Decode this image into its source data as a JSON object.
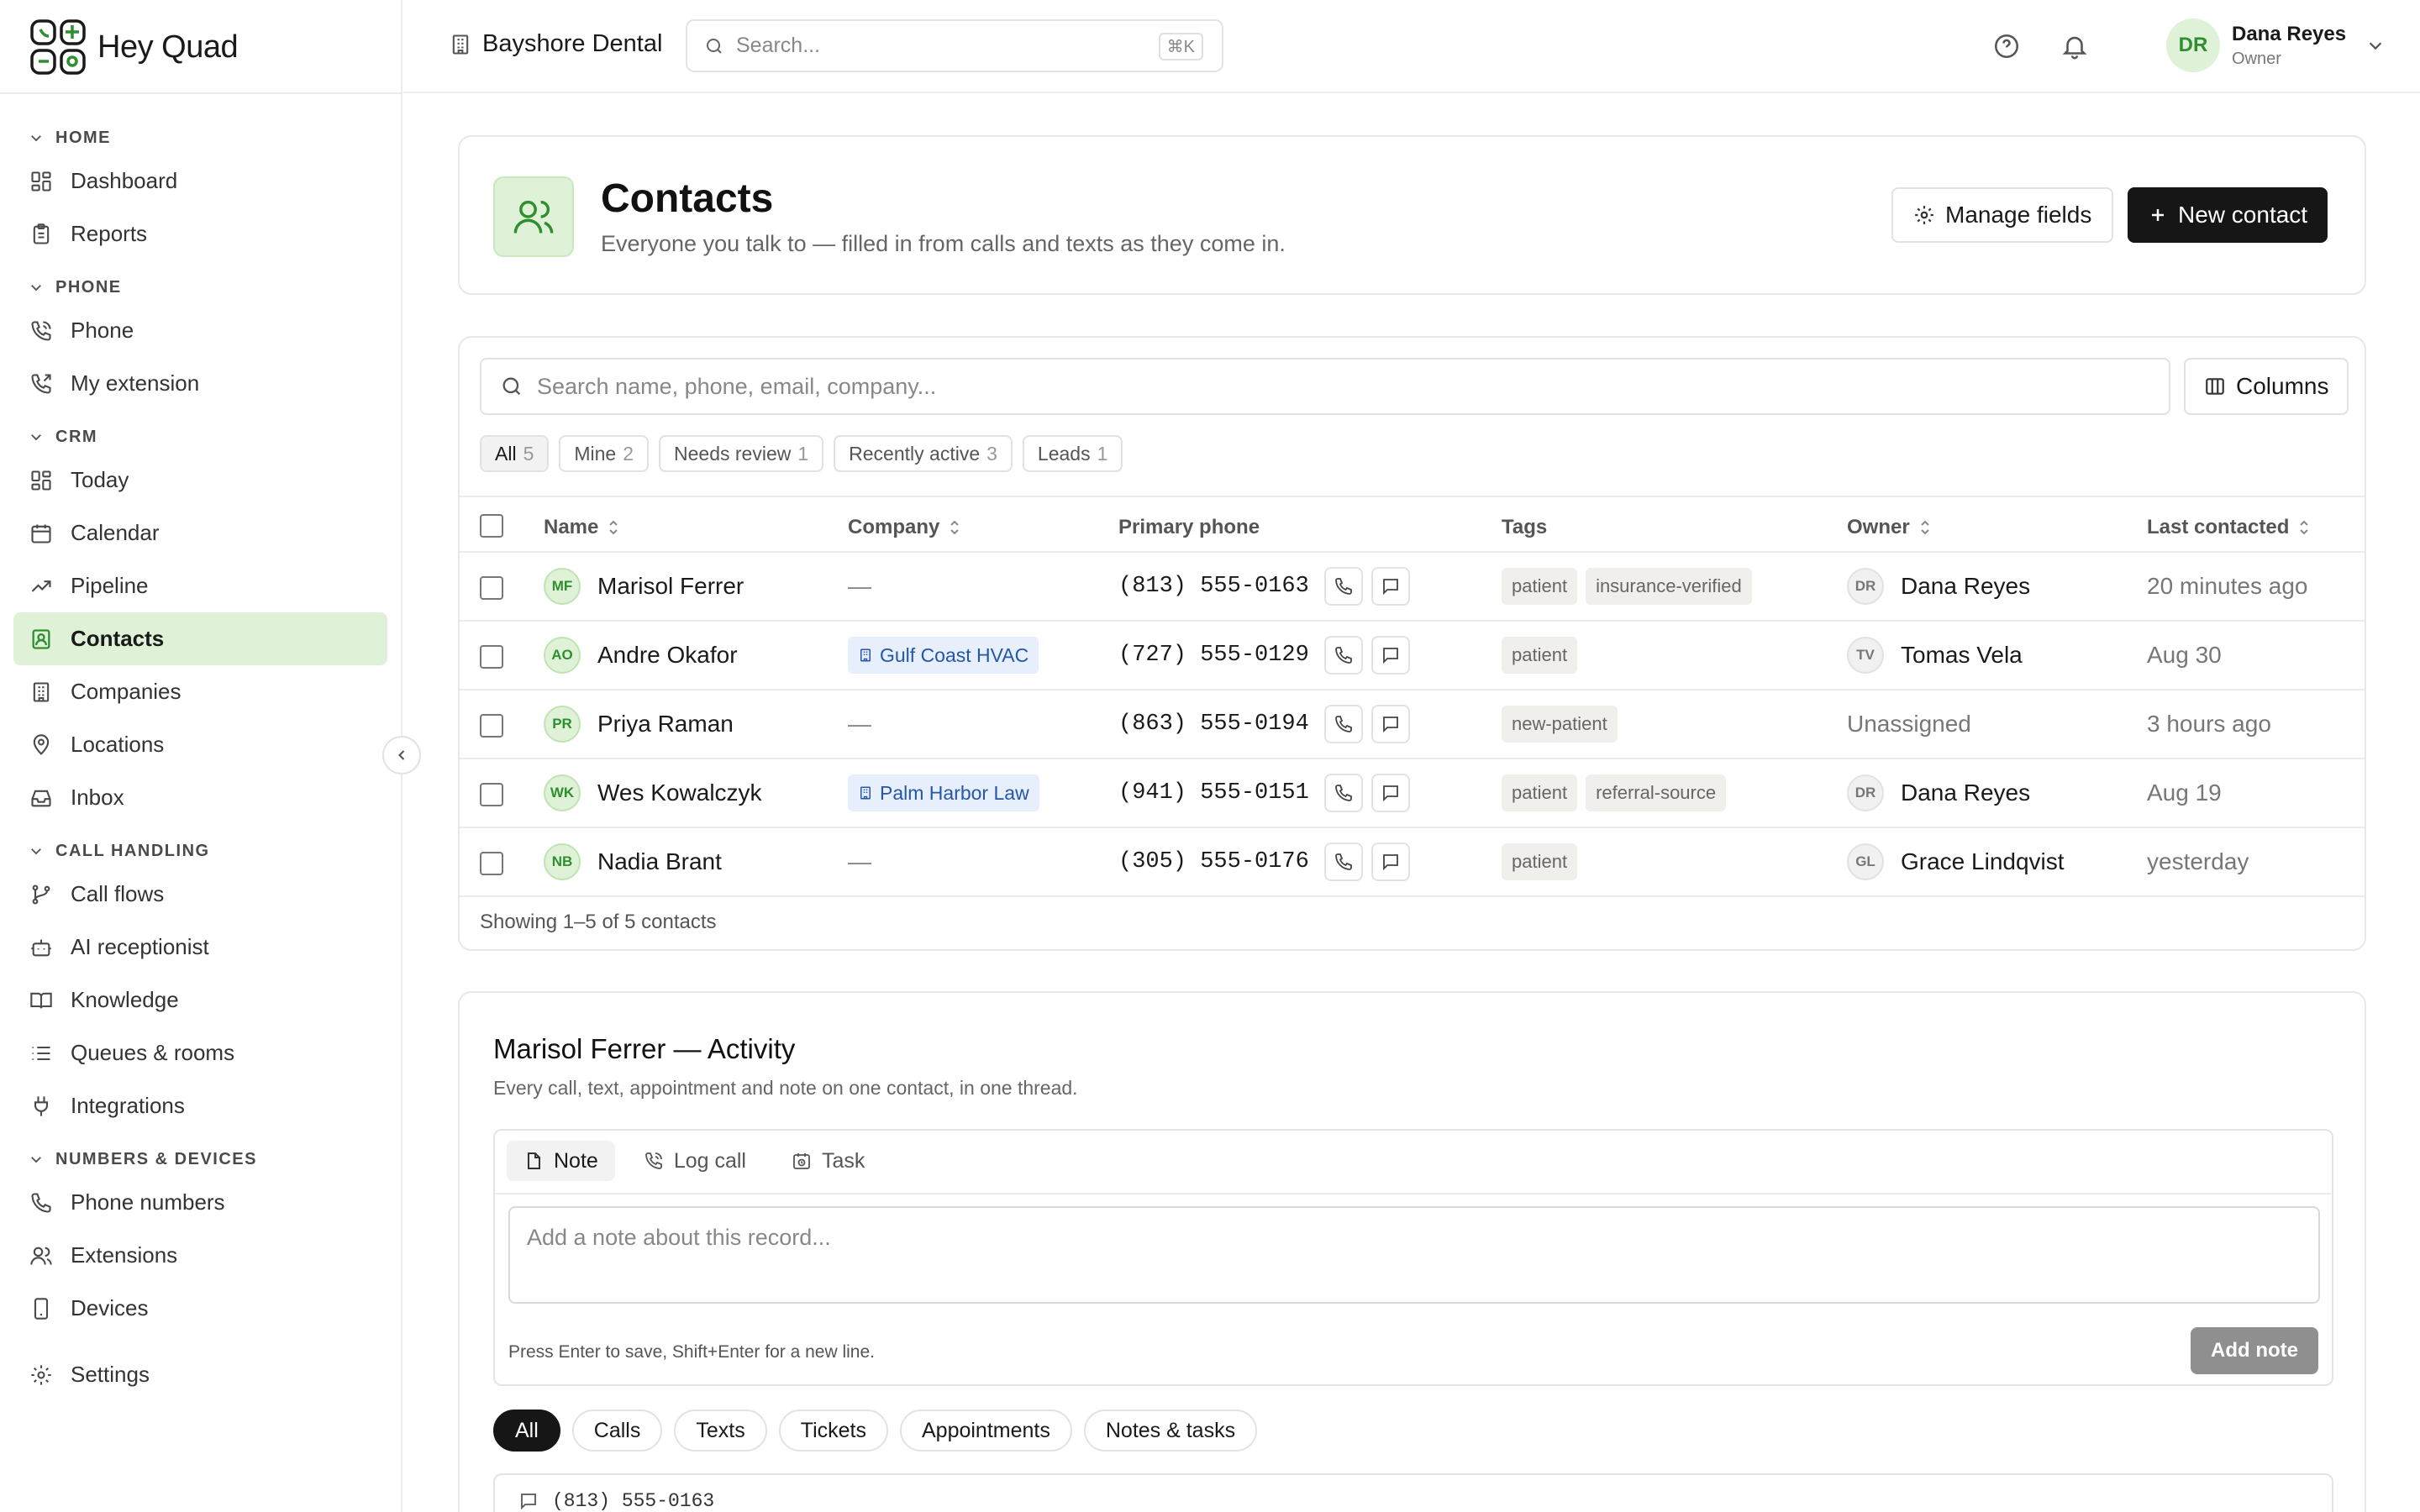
{
  "app": {
    "name": "Hey Quad"
  },
  "topbar": {
    "org_name": "Bayshore Dental",
    "search_placeholder": "Search...",
    "search_shortcut": "⌘K",
    "user": {
      "initials": "DR",
      "name": "Dana Reyes",
      "role": "Owner"
    }
  },
  "sidebar": {
    "groups": {
      "home": "HOME",
      "phone": "PHONE",
      "crm": "CRM",
      "call_handling": "CALL HANDLING",
      "numbers_devices": "NUMBERS & DEVICES"
    },
    "items": {
      "dashboard": "Dashboard",
      "reports": "Reports",
      "phone": "Phone",
      "my_extension": "My extension",
      "today": "Today",
      "calendar": "Calendar",
      "pipeline": "Pipeline",
      "contacts": "Contacts",
      "companies": "Companies",
      "locations": "Locations",
      "inbox": "Inbox",
      "call_flows": "Call flows",
      "ai_receptionist": "AI receptionist",
      "knowledge": "Knowledge",
      "queues_rooms": "Queues & rooms",
      "integrations": "Integrations",
      "phone_numbers": "Phone numbers",
      "extensions": "Extensions",
      "devices": "Devices",
      "settings": "Settings"
    },
    "active": "contacts"
  },
  "header": {
    "title": "Contacts",
    "subtitle": "Everyone you talk to — filled in from calls and texts as they come in.",
    "manage_fields_label": "Manage fields",
    "new_contact_label": "New contact"
  },
  "table": {
    "search_placeholder": "Search name, phone, email, company...",
    "columns_label": "Columns",
    "filters": [
      {
        "label": "All",
        "count": "5"
      },
      {
        "label": "Mine",
        "count": "2"
      },
      {
        "label": "Needs review",
        "count": "1"
      },
      {
        "label": "Recently active",
        "count": "3"
      },
      {
        "label": "Leads",
        "count": "1"
      }
    ],
    "headers": {
      "name": "Name",
      "company": "Company",
      "primary_phone": "Primary phone",
      "tags": "Tags",
      "owner": "Owner",
      "last_contacted": "Last contacted"
    },
    "rows": [
      {
        "initials": "MF",
        "name": "Marisol Ferrer",
        "company": "—",
        "phone": "(813) 555-0163",
        "tags": [
          "patient",
          "insurance-verified"
        ],
        "owner_initials": "DR",
        "owner": "Dana Reyes",
        "last": "20 minutes ago"
      },
      {
        "initials": "AO",
        "name": "Andre Okafor",
        "company": "Gulf Coast HVAC",
        "phone": "(727) 555-0129",
        "tags": [
          "patient"
        ],
        "owner_initials": "TV",
        "owner": "Tomas Vela",
        "last": "Aug 30"
      },
      {
        "initials": "PR",
        "name": "Priya Raman",
        "company": "—",
        "phone": "(863) 555-0194",
        "tags": [
          "new-patient"
        ],
        "owner_initials": "",
        "owner": "Unassigned",
        "last": "3 hours ago"
      },
      {
        "initials": "WK",
        "name": "Wes Kowalczyk",
        "company": "Palm Harbor Law",
        "phone": "(941) 555-0151",
        "tags": [
          "patient",
          "referral-source"
        ],
        "owner_initials": "DR",
        "owner": "Dana Reyes",
        "last": "Aug 19"
      },
      {
        "initials": "NB",
        "name": "Nadia Brant",
        "company": "—",
        "phone": "(305) 555-0176",
        "tags": [
          "patient"
        ],
        "owner_initials": "GL",
        "owner": "Grace Lindqvist",
        "last": "yesterday"
      }
    ],
    "footer": "Showing 1–5 of 5 contacts"
  },
  "activity": {
    "title": "Marisol Ferrer — Activity",
    "subtitle": "Every call, text, appointment and note on one contact, in one thread.",
    "tabs": {
      "note": "Note",
      "log_call": "Log call",
      "task": "Task"
    },
    "note_placeholder": "Add a note about this record...",
    "hint": "Press Enter to save, Shift+Enter for a new line.",
    "add_note_label": "Add note",
    "filters": [
      "All",
      "Calls",
      "Texts",
      "Tickets",
      "Appointments",
      "Notes & tasks"
    ],
    "first_item": "(813) 555-0163"
  },
  "colors": {
    "accent_green": "#2f8f2f",
    "accent_bg": "#dff2d8",
    "dark": "#161616",
    "company_blue": "#2656a8"
  }
}
